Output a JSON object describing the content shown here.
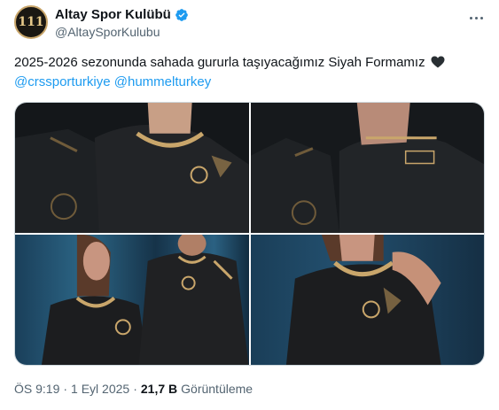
{
  "author": {
    "name": "Altay Spor Kulübü",
    "handle": "@AltaySporKulubu",
    "avatar_text": "111",
    "verified_icon": "verified-badge-icon"
  },
  "tweet": {
    "text": "2025-2026 sezonunda sahada gururla taşıyacağımız Siyah Formamız",
    "emoji_icon": "black-heart-icon",
    "mentions": [
      "@crssporturkiye",
      "@hummelturkey"
    ]
  },
  "media": {
    "photos": [
      {
        "alt": "jersey-front-closeup"
      },
      {
        "alt": "jersey-side-closeup"
      },
      {
        "alt": "two-models-wearing-jersey"
      },
      {
        "alt": "model-collar-closeup"
      }
    ]
  },
  "meta": {
    "time": "ÖS 9:19",
    "date": "1 Eyl 2025",
    "separator": "·",
    "views": "21,7 B",
    "views_label": "Görüntüleme"
  },
  "colors": {
    "accent": "#1d9bf0",
    "gold": "#c9a66b",
    "jersey": "#1b1c1e"
  }
}
